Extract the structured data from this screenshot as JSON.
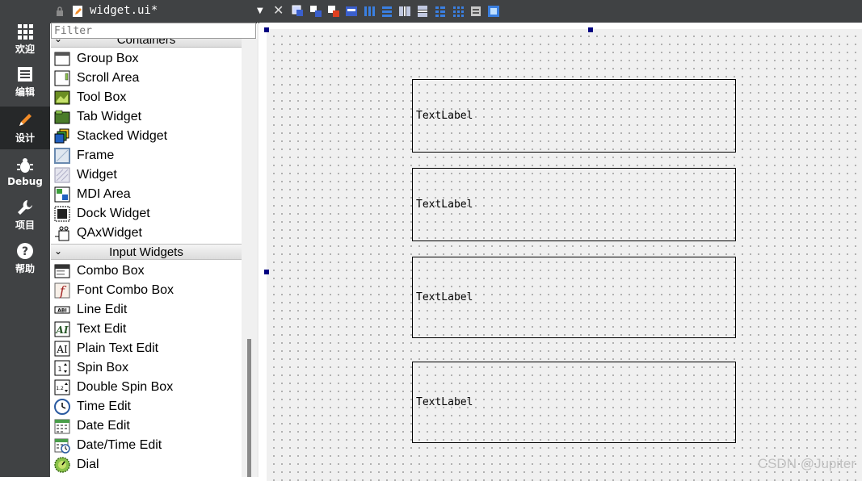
{
  "modes": [
    {
      "label": "欢迎",
      "icon": "grid-icon"
    },
    {
      "label": "编辑",
      "icon": "document-icon"
    },
    {
      "label": "设计",
      "icon": "pencil-icon"
    },
    {
      "label": "Debug",
      "icon": "bug-icon"
    },
    {
      "label": "项目",
      "icon": "wrench-icon"
    },
    {
      "label": "帮助",
      "icon": "help-icon"
    }
  ],
  "active_mode": "设计",
  "editor": {
    "filename": "widget.ui*"
  },
  "widgetbox": {
    "filter_placeholder": "Filter",
    "categories": {
      "containers": "Containers",
      "input": "Input Widgets"
    },
    "containers_items": [
      {
        "label": "Group Box",
        "icon": "group-box-icon"
      },
      {
        "label": "Scroll Area",
        "icon": "scroll-area-icon"
      },
      {
        "label": "Tool Box",
        "icon": "tool-box-icon"
      },
      {
        "label": "Tab Widget",
        "icon": "tab-widget-icon"
      },
      {
        "label": "Stacked Widget",
        "icon": "stacked-widget-icon"
      },
      {
        "label": "Frame",
        "icon": "frame-icon"
      },
      {
        "label": "Widget",
        "icon": "widget-icon"
      },
      {
        "label": "MDI Area",
        "icon": "mdi-area-icon"
      },
      {
        "label": "Dock Widget",
        "icon": "dock-widget-icon"
      },
      {
        "label": "QAxWidget",
        "icon": "qaxwidget-icon"
      }
    ],
    "input_items": [
      {
        "label": "Combo Box",
        "icon": "combo-box-icon"
      },
      {
        "label": "Font Combo Box",
        "icon": "font-combo-box-icon"
      },
      {
        "label": "Line Edit",
        "icon": "line-edit-icon"
      },
      {
        "label": "Text Edit",
        "icon": "text-edit-icon"
      },
      {
        "label": "Plain Text Edit",
        "icon": "plain-text-edit-icon"
      },
      {
        "label": "Spin Box",
        "icon": "spin-box-icon"
      },
      {
        "label": "Double Spin Box",
        "icon": "double-spin-box-icon"
      },
      {
        "label": "Time Edit",
        "icon": "time-edit-icon"
      },
      {
        "label": "Date Edit",
        "icon": "date-edit-icon"
      },
      {
        "label": "Date/Time Edit",
        "icon": "datetime-edit-icon"
      },
      {
        "label": "Dial",
        "icon": "dial-icon"
      }
    ]
  },
  "form": {
    "labels": [
      "TextLabel",
      "TextLabel",
      "TextLabel",
      "TextLabel"
    ]
  },
  "watermark": "CSDN @Jupiter"
}
